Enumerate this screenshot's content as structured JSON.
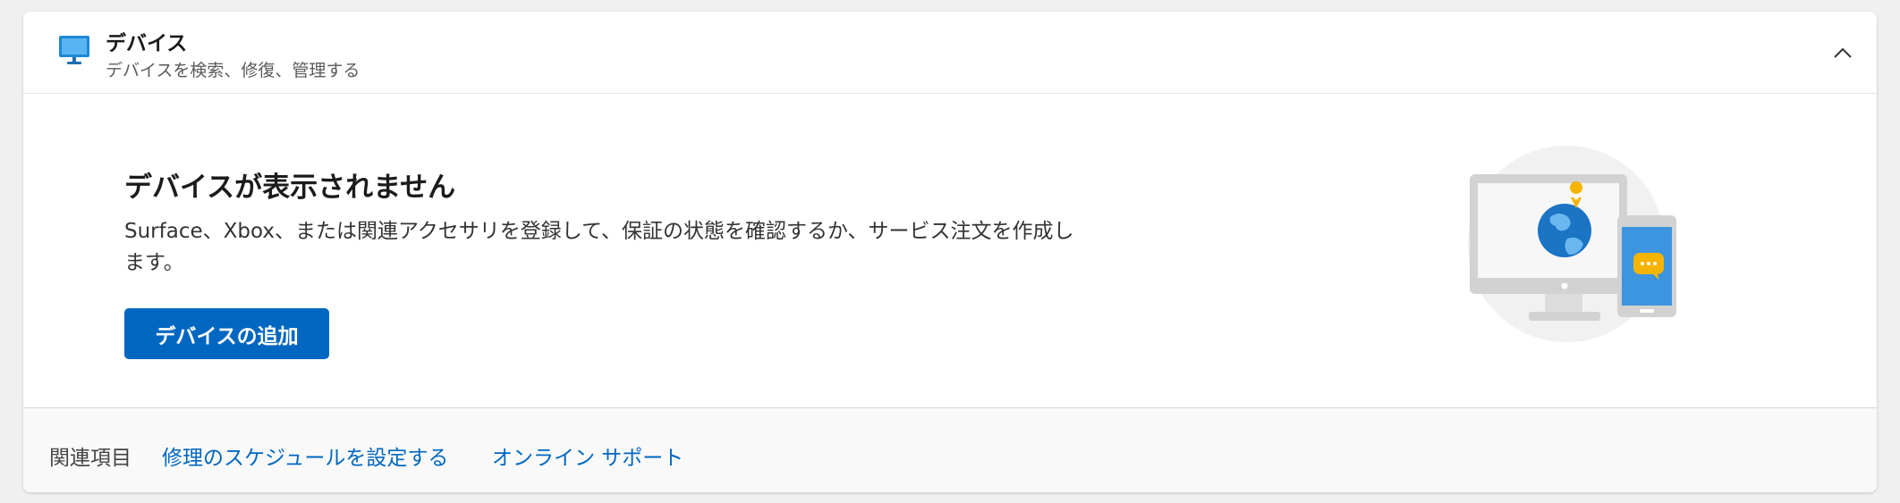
{
  "header": {
    "title": "デバイス",
    "subtitle": "デバイスを検索、修復、管理する",
    "icon": "monitor-icon",
    "collapse_icon": "chevron-up-icon"
  },
  "empty_state": {
    "title": "デバイスが表示されません",
    "description": "Surface、Xbox、または関連アクセサリを登録して、保証の状態を確認するか、サービス注文を作成します。",
    "add_button_label": "デバイスの追加",
    "illustration": "devices-illustration"
  },
  "footer": {
    "related_label": "関連項目",
    "links": [
      {
        "label": "修理のスケジュールを設定する"
      },
      {
        "label": "オンライン サポート"
      }
    ]
  },
  "colors": {
    "accent": "#0067c0",
    "link": "#0067c0",
    "card_bg": "#ffffff",
    "page_bg": "#f0f0f0"
  }
}
